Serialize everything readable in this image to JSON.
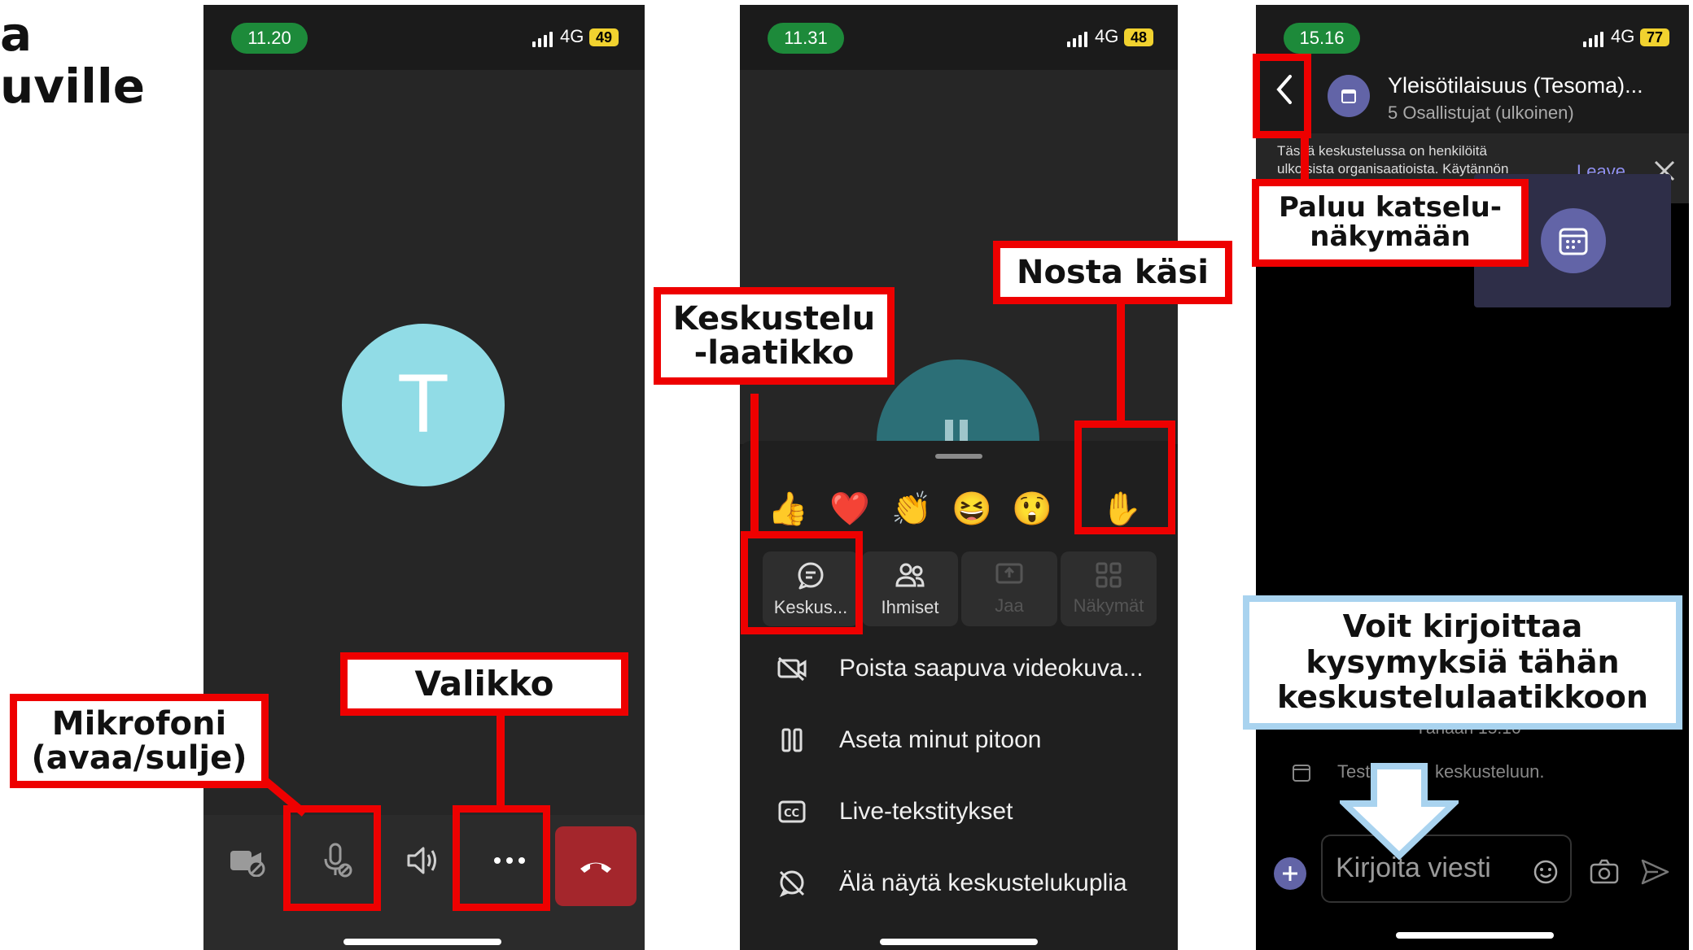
{
  "slide": {
    "title_lines": [
      "a",
      "uville"
    ]
  },
  "phone1": {
    "time": "11.20",
    "network": "4G",
    "battery": "49",
    "avatar_letter": "T",
    "controls": [
      "camera-off-icon",
      "mic-off-icon",
      "speaker-icon",
      "more-icon",
      "hang-up-icon"
    ]
  },
  "phone2": {
    "time": "11.31",
    "network": "4G",
    "battery": "48",
    "reactions": [
      "👍",
      "❤️",
      "👏",
      "😆",
      "😲",
      "✋"
    ],
    "tiles": [
      {
        "label": "Keskus..."
      },
      {
        "label": "Ihmiset"
      },
      {
        "label": "Jaa"
      },
      {
        "label": "Näkymät"
      }
    ],
    "menu": [
      {
        "label": "Poista saapuva videokuva..."
      },
      {
        "label": "Aseta minut pitoon"
      },
      {
        "label": "Live-tekstitykset"
      },
      {
        "label": "Älä näytä keskustelukuplia"
      }
    ]
  },
  "phone3": {
    "time": "15.16",
    "network": "4G",
    "battery": "77",
    "chat_title": "Yleisötilaisuus (Tesoma)...",
    "chat_subtitle": "5 Osallistujat (ulkoinen)",
    "banner_line1": "Tässä keskustelussa on henkilöitä",
    "banner_line2": "ulkoisista organisaatioista. Käytännön",
    "banner_leave": "Leave",
    "timestamp": "Tänään 15.16",
    "message_start": "Test",
    "message_end": "keskusteluun.",
    "input_placeholder": "Kirjoita viesti"
  },
  "callouts": {
    "mikrofoni": [
      "Mikrofoni",
      "(avaa/sulje)"
    ],
    "valikko": "Valikko",
    "keskustelu": [
      "Keskustelu",
      "-laatikko"
    ],
    "nosta": "Nosta käsi",
    "paluu": [
      "Paluu katselu-",
      "näkymään"
    ],
    "voit": [
      "Voit kirjoittaa",
      "kysymyksiä tähän",
      "keskustelulaatikkoon"
    ]
  },
  "colors": {
    "alert_red": "#ee0000",
    "callout_blue": "#a9d3ef",
    "teams_purple": "#6264a7",
    "avatar_cyan": "#91dce6",
    "hangup_red": "#a4262c"
  }
}
